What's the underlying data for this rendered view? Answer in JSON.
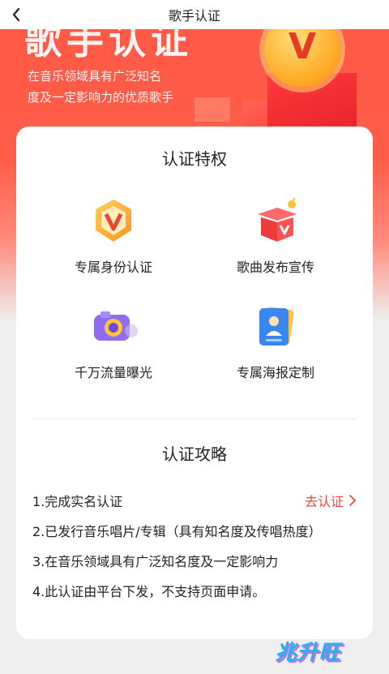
{
  "header": {
    "title": "歌手认证",
    "back_icon": "chevron-left-icon"
  },
  "hero": {
    "headline": "歌手认证",
    "subtitle_line1": "在音乐领域具有广泛知名",
    "subtitle_line2": "度及一定影响力的优质歌手",
    "badge_letter": "V"
  },
  "privileges": {
    "title": "认证特权",
    "items": [
      {
        "label": "专属身份认证",
        "icon": "vip-badge-icon"
      },
      {
        "label": "歌曲发布宣传",
        "icon": "gift-box-icon"
      },
      {
        "label": "千万流量曝光",
        "icon": "camera-icon"
      },
      {
        "label": "专属海报定制",
        "icon": "poster-icon"
      }
    ]
  },
  "guide": {
    "title": "认证攻略",
    "steps": [
      "1.完成实名认证",
      "2.已发行音乐唱片/专辑（具有知名度及传唱热度）",
      "3.在音乐领域具有广泛知名度及一定影响力",
      "4.此认证由平台下发，不支持页面申请。"
    ],
    "action_label": "去认证"
  },
  "watermark": {
    "text": "兆升旺"
  },
  "colors": {
    "accent": "#f0453a",
    "hero": "#ff5a46",
    "card": "#ffffff"
  }
}
